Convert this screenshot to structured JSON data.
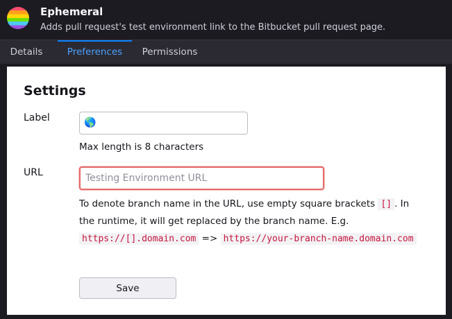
{
  "header": {
    "title": "Ephemeral",
    "description": "Adds pull request's test environment link to the Bitbucket pull request page.",
    "logo_icon": "rainbow-circle-icon"
  },
  "tabs": [
    {
      "label": "Details",
      "active": false
    },
    {
      "label": "Preferences",
      "active": true
    },
    {
      "label": "Permissions",
      "active": false
    }
  ],
  "settings": {
    "title": "Settings",
    "label_field": {
      "label": "Label",
      "value": "🌎",
      "help": "Max length is 8 characters"
    },
    "url_field": {
      "label": "URL",
      "value": "",
      "placeholder": "Testing Environment URL",
      "help_intro": "To denote branch name in the URL, use empty square brackets",
      "help_brackets": "[]",
      "help_mid": ". In the runtime, it will get replaced by the branch name. E.g.",
      "example_from": "https://[].domain.com",
      "arrow": "=>",
      "example_to": "https://your-branch-name.domain.com"
    },
    "save_label": "Save"
  },
  "colors": {
    "accent": "#0a84ff",
    "error_border": "#e26b6b",
    "code_text": "#c5153e"
  }
}
